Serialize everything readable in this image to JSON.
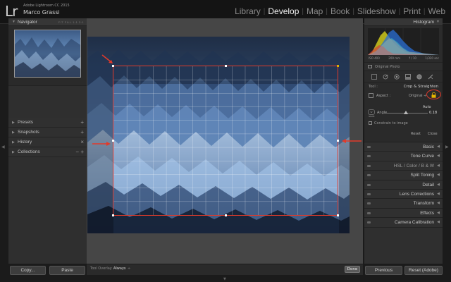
{
  "identity": {
    "logo": "Lr",
    "app_name": "Adobe Lightroom CC 2015",
    "user_name": "Marco Grassi"
  },
  "modules": {
    "library": "Library",
    "develop": "Develop",
    "map": "Map",
    "book": "Book",
    "slideshow": "Slideshow",
    "print": "Print",
    "web": "Web",
    "active": "Develop",
    "separator": "|"
  },
  "left_panel": {
    "navigator": {
      "label": "Navigator",
      "modes": "FIT FILL 1:1 3:1"
    },
    "presets": {
      "label": "Presets",
      "action": "+"
    },
    "snapshots": {
      "label": "Snapshots",
      "action": "+"
    },
    "history": {
      "label": "History",
      "action": "×"
    },
    "collections": {
      "label": "Collections",
      "action": "− +"
    },
    "copy_label": "Copy...",
    "paste_label": "Paste"
  },
  "toolbar": {
    "overlay_label": "Tool Overlay :",
    "overlay_value": "Always",
    "overlay_caret": "÷",
    "done_label": "Done"
  },
  "right_panel": {
    "histogram_label": "Histogram",
    "exif": {
      "iso": "ISO 400",
      "focal": "200 mm",
      "aperture": "f / 10",
      "shutter": "1/320 sec"
    },
    "original_photo_label": "Original Photo",
    "crop": {
      "tool_label": "Tool :",
      "title": "Crop & Straighten",
      "aspect_label": "Aspect :",
      "aspect_value": "Original ÷",
      "auto_label": "Auto",
      "straighten_icon_text": "W GRAB",
      "angle_label": "Angle",
      "angle_value": "0.18",
      "angle_level": 0.5,
      "constrain_label": "Constrain to image",
      "reset_label": "Reset",
      "close_label": "Close"
    },
    "sections": [
      {
        "label": "Basic"
      },
      {
        "label": "Tone Curve"
      },
      {
        "label": "HSL  /  Color  /  B & W"
      },
      {
        "label": "Split Toning"
      },
      {
        "label": "Detail"
      },
      {
        "label": "Lens Corrections"
      },
      {
        "label": "Transform"
      },
      {
        "label": "Effects"
      },
      {
        "label": "Camera Calibration"
      }
    ],
    "previous_label": "Previous",
    "reset_adobe_label": "Reset (Adobe)"
  },
  "colors": {
    "accent_red": "#e23a2a",
    "panel_bg": "#2f2f2f",
    "canvas_bg": "#464646",
    "active_module": "#f0f0f0"
  },
  "icons": {
    "crop_overlay": "crop-grid-icon",
    "spot_removal": "spot-removal-icon",
    "red_eye": "red-eye-icon",
    "graduated_filter": "graduated-filter-icon",
    "radial_filter": "radial-filter-icon",
    "adjustment_brush": "adjustment-brush-icon",
    "lock": "lock-icon"
  }
}
